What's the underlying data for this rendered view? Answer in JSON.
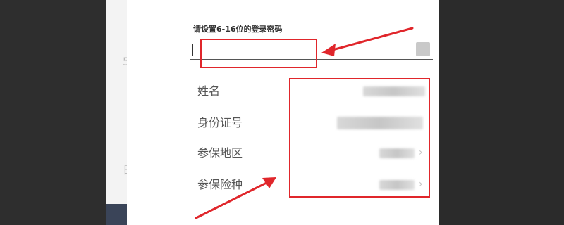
{
  "dialog": {
    "password_prompt": "请设置6-16位的登录密码",
    "password_value": "",
    "rows": [
      {
        "label": "姓名"
      },
      {
        "label": "身份证号"
      },
      {
        "label": "参保地区"
      },
      {
        "label": "参保险种"
      }
    ]
  },
  "background": {
    "glyph_1": "5",
    "glyph_2": "日"
  },
  "colors": {
    "annotation_red": "#e0262b",
    "background_dark": "#2b2b2b",
    "dialog_bg": "#ffffff"
  }
}
